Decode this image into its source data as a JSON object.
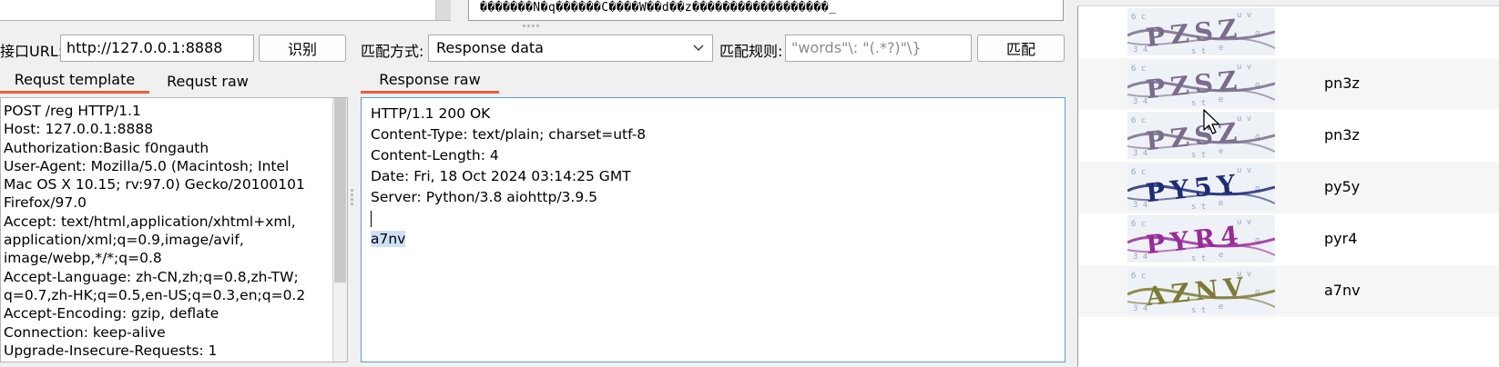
{
  "top": {
    "encoded_text": "�������N�q������C����W��d��z������������������_"
  },
  "left": {
    "url_label": "接口URL:",
    "url_value": "http://127.0.0.1:8888",
    "identify_button": "识别",
    "tabs": [
      {
        "label": "Requst template",
        "active": true
      },
      {
        "label": "Requst raw",
        "active": false
      }
    ],
    "request_lines": [
      "POST /reg HTTP/1.1",
      "Host: 127.0.0.1:8888",
      "Authorization:Basic f0ngauth",
      "User-Agent: Mozilla/5.0 (Macintosh; Intel",
      "Mac OS X 10.15; rv:97.0) Gecko/20100101",
      "Firefox/97.0",
      "Accept: text/html,application/xhtml+xml,",
      "application/xml;q=0.9,image/avif,",
      "image/webp,*/*;q=0.8",
      "Accept-Language: zh-CN,zh;q=0.8,zh-TW;",
      "q=0.7,zh-HK;q=0.5,en-US;q=0.3,en;q=0.2",
      "Accept-Encoding: gzip, deflate",
      "Connection: keep-alive",
      "Upgrade-Insecure-Requests: 1"
    ]
  },
  "middle": {
    "match_mode_label": "匹配方式:",
    "match_mode_value": "Response data",
    "match_rule_label": "匹配规则:",
    "match_rule_placeholder": "\"words\"\\: \"(.*?)\"\\}",
    "match_button": "匹配",
    "tab": "Response raw",
    "response_lines": [
      "HTTP/1.1 200 OK",
      "Content-Type: text/plain; charset=utf-8",
      "Content-Length: 4",
      "Date: Fri, 18 Oct 2024 03:14:25 GMT",
      "Server: Python/3.8 aiohttp/3.9.5",
      ""
    ],
    "selected_text": "a7nv"
  },
  "results": {
    "rows": [
      {
        "result": "",
        "captcha_text": "PZSZ",
        "color": "#7a6c8c"
      },
      {
        "result": "pn3z",
        "captcha_text": "PZSZ",
        "color": "#7a6c8c"
      },
      {
        "result": "pn3z",
        "captcha_text": "PZSZ",
        "color": "#7a6c8c"
      },
      {
        "result": "py5y",
        "captcha_text": "PY5Y",
        "color": "#1e2b78"
      },
      {
        "result": "pyr4",
        "captcha_text": "PYR4",
        "color": "#9a2a9a"
      },
      {
        "result": "a7nv",
        "captcha_text": "AZNV",
        "color": "#7c7a34"
      }
    ]
  },
  "colors": {
    "tab_underline": "#e8603c",
    "focus_border": "#5b9bd5",
    "selection": "#cfe0f4"
  }
}
